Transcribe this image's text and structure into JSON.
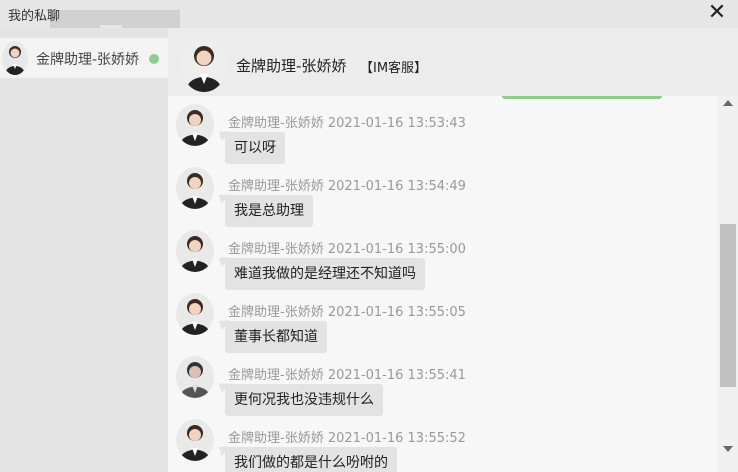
{
  "window": {
    "title": "我的私聊",
    "close_icon": "close-icon"
  },
  "contacts": [
    {
      "name": "金牌助理-张娇娇",
      "status_color": "#8fcc8f",
      "avatar_icon": "avatar-icon"
    }
  ],
  "chat": {
    "name": "金牌助理-张娇娇",
    "tag": "【IM客服】"
  },
  "messages": [
    {
      "sender": "金牌助理-张娇娇",
      "time": "2021-01-16 13:53:43",
      "text": "可以呀"
    },
    {
      "sender": "金牌助理-张娇娇",
      "time": "2021-01-16 13:54:49",
      "text": "我是总助理"
    },
    {
      "sender": "金牌助理-张娇娇",
      "time": "2021-01-16 13:55:00",
      "text": "难道我做的是经理还不知道吗"
    },
    {
      "sender": "金牌助理-张娇娇",
      "time": "2021-01-16 13:55:05",
      "text": "董事长都知道"
    },
    {
      "sender": "金牌助理-张娇娇",
      "time": "2021-01-16 13:55:41",
      "text": "更何况我也没违规什么"
    },
    {
      "sender": "金牌助理-张娇娇",
      "time": "2021-01-16 13:55:52",
      "text": "我们做的都是什么吩咐的"
    }
  ],
  "colors": {
    "accent_green": "#8fcc8f",
    "bubble": "#e3e3e3"
  }
}
